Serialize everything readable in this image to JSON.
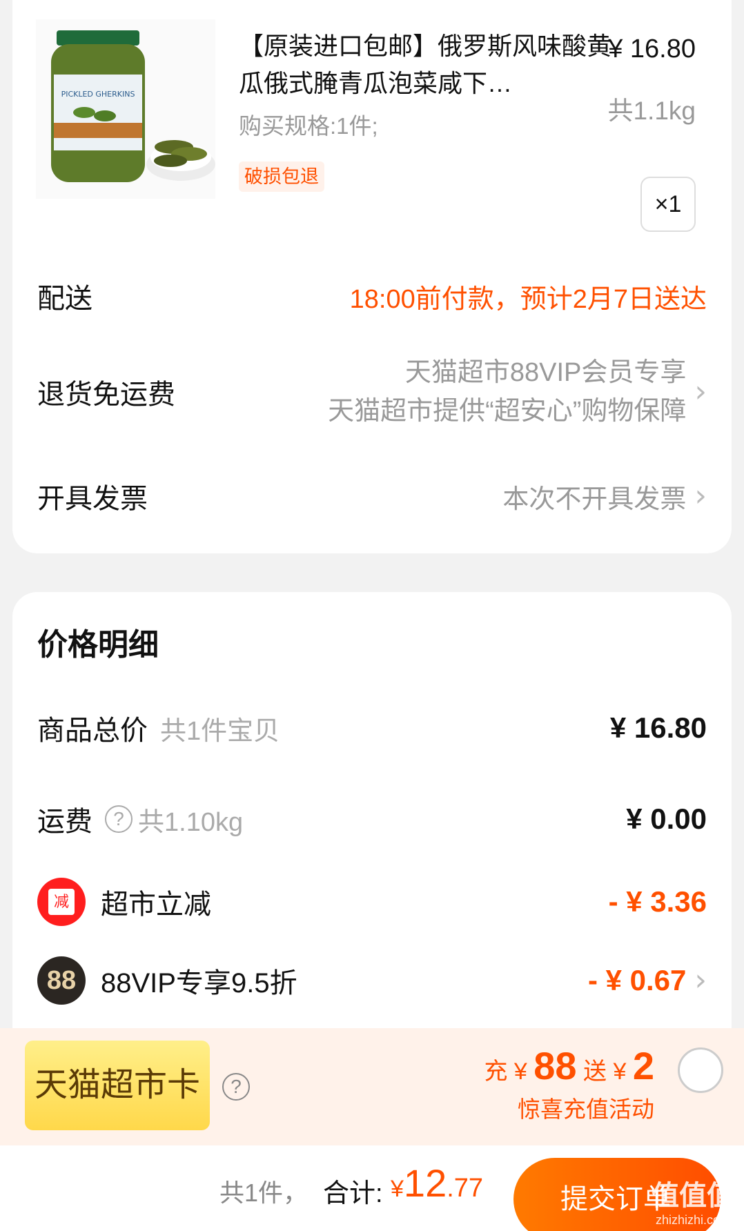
{
  "product": {
    "title": "【原装进口包邮】俄罗斯风味酸黄瓜俄式腌青瓜泡菜咸下…",
    "spec": "购买规格:1件;",
    "badge": "破损包退",
    "price": "¥ 16.80",
    "weight": "共1.1kg",
    "quantity": "×1",
    "image_label": "PICKLED GHERKINS"
  },
  "delivery": {
    "label": "配送",
    "value": "18:00前付款，预计2月7日送达"
  },
  "returns": {
    "label": "退货免运费",
    "line1": "天猫超市88VIP会员专享",
    "line2": "天猫超市提供“超安心”购物保障"
  },
  "invoice": {
    "label": "开具发票",
    "value": "本次不开具发票"
  },
  "price_detail": {
    "title": "价格明细",
    "goods_total_label": "商品总价",
    "goods_total_sub": "共1件宝贝",
    "goods_total": "¥ 16.80",
    "shipping_label": "运费",
    "shipping_help": "?",
    "shipping_sub": "共1.10kg",
    "shipping": "¥ 0.00",
    "discount1_icon_text": "减",
    "discount1_label": "超市立减",
    "discount1": "- ¥ 3.36",
    "discount2_icon_text": "88",
    "discount2_label": "88VIP专享9.5折",
    "discount2": "- ¥ 0.67"
  },
  "tmall_card": {
    "button": "天猫超市卡",
    "help": "?",
    "charge_prefix": "充",
    "charge_currency": "¥",
    "charge_amount": "88",
    "gift_prefix": "送",
    "gift_currency": "¥",
    "gift_amount": "2",
    "activity": "惊喜充值活动"
  },
  "footer": {
    "count": "共1件，",
    "total_label": "合计:",
    "currency": "¥",
    "total_int": "12",
    "total_dec": ".77",
    "submit": "提交订单"
  },
  "watermark": {
    "text": "值值值",
    "url": "zhizhizhi.com"
  },
  "colors": {
    "accent": "#ff5000",
    "page_bg": "#f2f2f2",
    "card_bg": "#ffffff"
  }
}
